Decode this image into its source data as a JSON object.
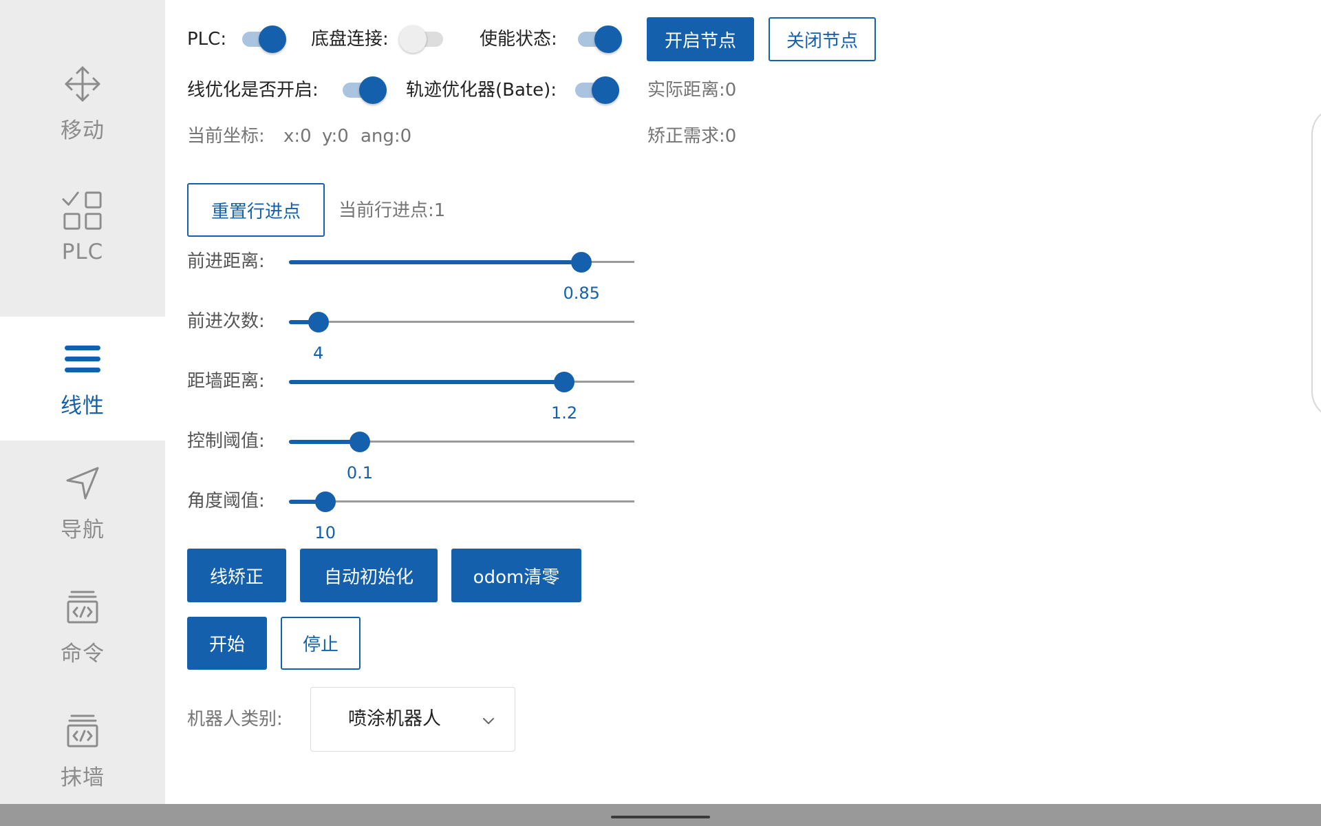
{
  "sidebar": {
    "items": [
      {
        "label": "移动",
        "icon": "move-icon",
        "active": false
      },
      {
        "label": "PLC",
        "icon": "grid-check-icon",
        "active": false
      },
      {
        "label": "线性",
        "icon": "menu-icon",
        "active": true
      },
      {
        "label": "导航",
        "icon": "navigation-icon",
        "active": false
      },
      {
        "label": "命令",
        "icon": "code-box-icon",
        "active": false
      },
      {
        "label": "抹墙",
        "icon": "code-box-icon",
        "active": false
      }
    ]
  },
  "toggles": {
    "plc": {
      "label": "PLC:",
      "on": true
    },
    "chassis": {
      "label": "底盘连接:",
      "on": false
    },
    "enable": {
      "label": "使能状态:",
      "on": true
    },
    "line_opt": {
      "label": "线优化是否开启:",
      "on": true
    },
    "traj_opt": {
      "label": "轨迹优化器(Bate):",
      "on": true
    }
  },
  "node_buttons": {
    "start": "开启节点",
    "stop": "关闭节点"
  },
  "status": {
    "actual_distance": "实际距离:0",
    "correction_demand": "矫正需求:0",
    "coord_label": "当前坐标:",
    "x": "x:0",
    "y": "y:0",
    "ang": "ang:0"
  },
  "progress": {
    "reset_button": "重置行进点",
    "current_point": "当前行进点:1"
  },
  "sliders": [
    {
      "label": "前进距离:",
      "value": "0.85",
      "fraction": 0.847
    },
    {
      "label": "前进次数:",
      "value": "4",
      "fraction": 0.085
    },
    {
      "label": "距墙距离:",
      "value": "1.2",
      "fraction": 0.797
    },
    {
      "label": "控制阈值:",
      "value": "0.1",
      "fraction": 0.205
    },
    {
      "label": "角度阈值:",
      "value": "10",
      "fraction": 0.105
    }
  ],
  "actions": {
    "line_correct": "线矫正",
    "auto_init": "自动初始化",
    "odom_reset": "odom清零"
  },
  "run": {
    "start": "开始",
    "stop": "停止"
  },
  "robot_type": {
    "label": "机器人类别:",
    "value": "喷涂机器人"
  },
  "colors": {
    "accent": "#1560ac",
    "sidebar_bg": "#ececec",
    "muted_text": "#757575"
  }
}
